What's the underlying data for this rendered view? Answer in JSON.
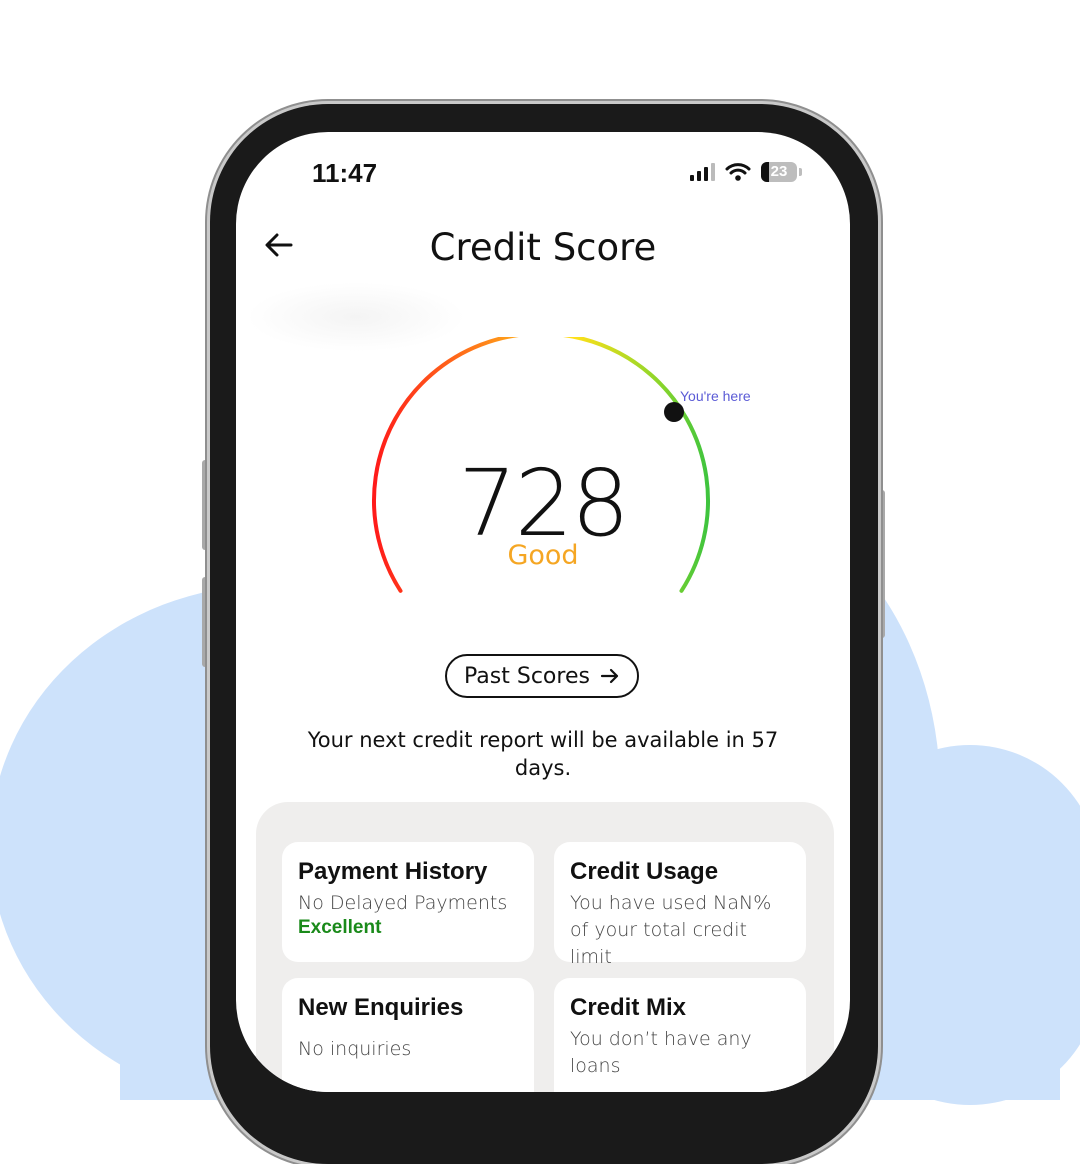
{
  "status_bar": {
    "time": "11:47",
    "battery": "23"
  },
  "header": {
    "title": "Credit Score"
  },
  "score": {
    "value": "728",
    "rating": "Good",
    "marker_label": "You're here"
  },
  "past_scores": {
    "label": "Past Scores"
  },
  "next_report": {
    "text": "Your next credit report will be available in 57 days."
  },
  "cards": [
    {
      "title": "Payment History",
      "text": "No Delayed Payments",
      "status": "Excellent"
    },
    {
      "title": "Credit Usage",
      "text": "You have used NaN% of your total credit limit"
    },
    {
      "title": "New Enquiries",
      "text": "No inquiries"
    },
    {
      "title": "Credit Mix",
      "text": "You don’t have any loans"
    }
  ],
  "colors": {
    "rating": "#f5a623",
    "excellent": "#1a8a1a",
    "background_shape": "#cde2fb",
    "marker_label": "#5b5bd6"
  },
  "icons": {
    "back": "arrow-left-icon",
    "past_scores": "arrow-right-icon",
    "signal": "signal-icon",
    "wifi": "wifi-icon",
    "battery": "battery-icon"
  }
}
